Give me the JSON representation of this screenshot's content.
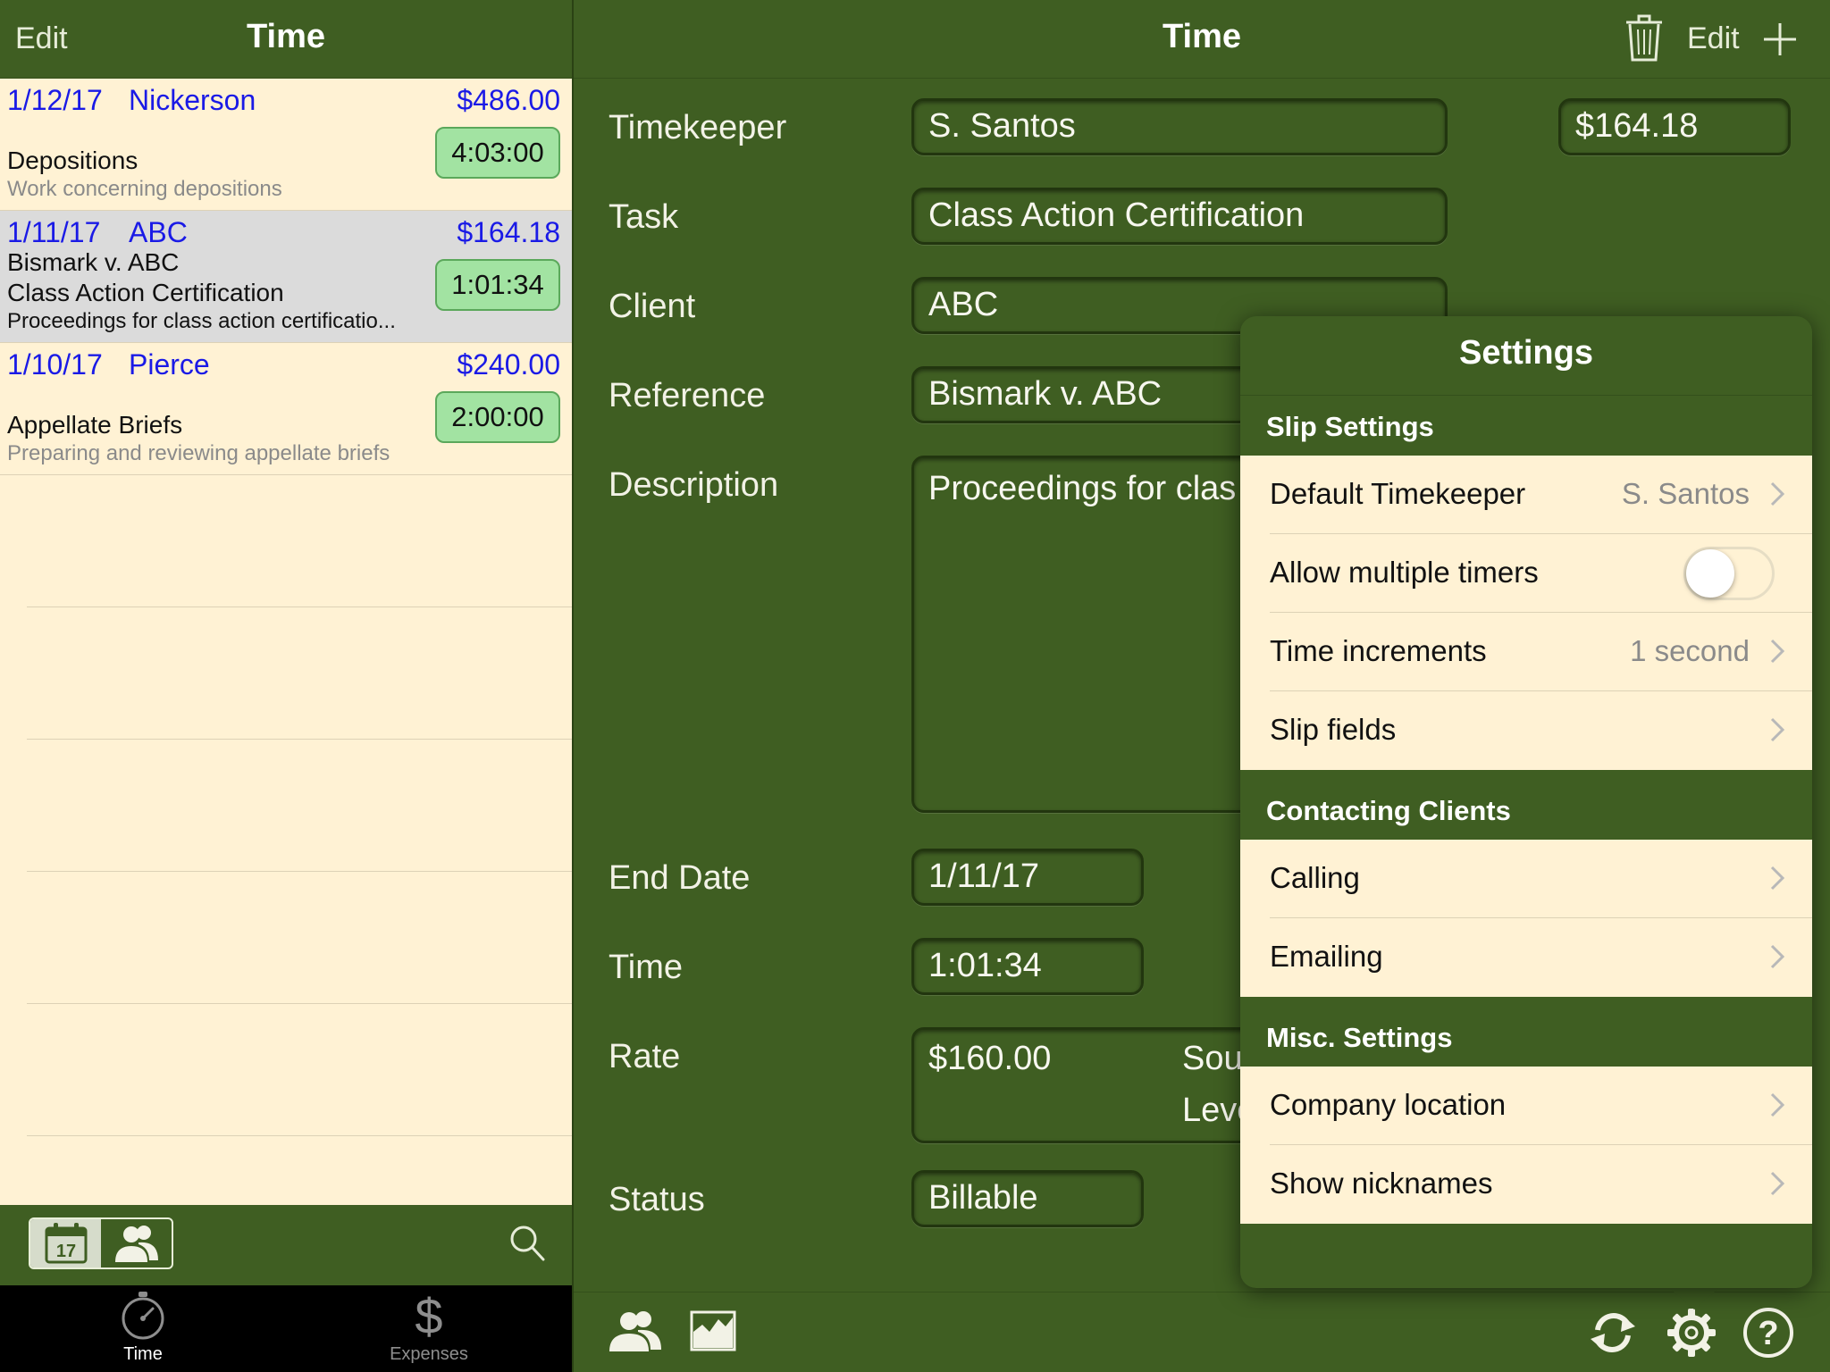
{
  "colors": {
    "bar_green": "#3f5e22",
    "list_bg": "#fff2d4",
    "link_blue": "#1a1ae6",
    "duration_green": "#a2e3a2"
  },
  "left": {
    "nav": {
      "edit_label": "Edit",
      "title": "Time"
    },
    "rows": [
      {
        "date": "1/12/17",
        "client": "Nickerson",
        "amount": "$486.00",
        "line2": "Depositions",
        "line3": "Work concerning depositions",
        "duration": "4:03:00",
        "selected": false
      },
      {
        "date": "1/11/17",
        "client": "ABC",
        "amount": "$164.18",
        "line2": "Bismark v. ABC",
        "line3": "Class Action Certification",
        "line4": "Proceedings for class action certificatio...",
        "duration": "1:01:34",
        "selected": true
      },
      {
        "date": "1/10/17",
        "client": "Pierce",
        "amount": "$240.00",
        "line2": "Appellate Briefs",
        "line3": "Preparing and reviewing appellate briefs",
        "duration": "2:00:00",
        "selected": false
      }
    ],
    "toolbar": {
      "calendar_day": "17"
    },
    "tabs": [
      {
        "label": "Time",
        "icon": "stopwatch-icon",
        "active": true
      },
      {
        "label": "Expenses",
        "icon": "dollar-icon",
        "active": false
      }
    ]
  },
  "detail": {
    "nav": {
      "title": "Time",
      "edit_label": "Edit"
    },
    "fields": {
      "timekeeper_label": "Timekeeper",
      "timekeeper": "S. Santos",
      "amount": "$164.18",
      "task_label": "Task",
      "task": "Class Action Certification",
      "client_label": "Client",
      "client": "ABC",
      "reference_label": "Reference",
      "reference": "Bismark v. ABC",
      "description_label": "Description",
      "description": "Proceedings for clas",
      "end_date_label": "End Date",
      "end_date": "1/11/17",
      "time_label": "Time",
      "time": "1:01:34",
      "rate_label": "Rate",
      "rate": "$160.00",
      "rate_source_1": "Sou",
      "rate_source_2": "Leve",
      "status_label": "Status",
      "status": "Billable"
    }
  },
  "settings": {
    "title": "Settings",
    "sections": [
      {
        "header": "Slip Settings",
        "items": [
          {
            "label": "Default Timekeeper",
            "value": "S. Santos",
            "type": "disclosure"
          },
          {
            "label": "Allow multiple timers",
            "type": "toggle",
            "on": false
          },
          {
            "label": "Time increments",
            "value": "1 second",
            "type": "disclosure"
          },
          {
            "label": "Slip fields",
            "type": "disclosure"
          }
        ]
      },
      {
        "header": "Contacting Clients",
        "items": [
          {
            "label": "Calling",
            "type": "disclosure"
          },
          {
            "label": "Emailing",
            "type": "disclosure"
          }
        ]
      },
      {
        "header": "Misc. Settings",
        "items": [
          {
            "label": "Company location",
            "type": "disclosure"
          },
          {
            "label": "Show nicknames",
            "type": "disclosure"
          }
        ]
      }
    ]
  }
}
